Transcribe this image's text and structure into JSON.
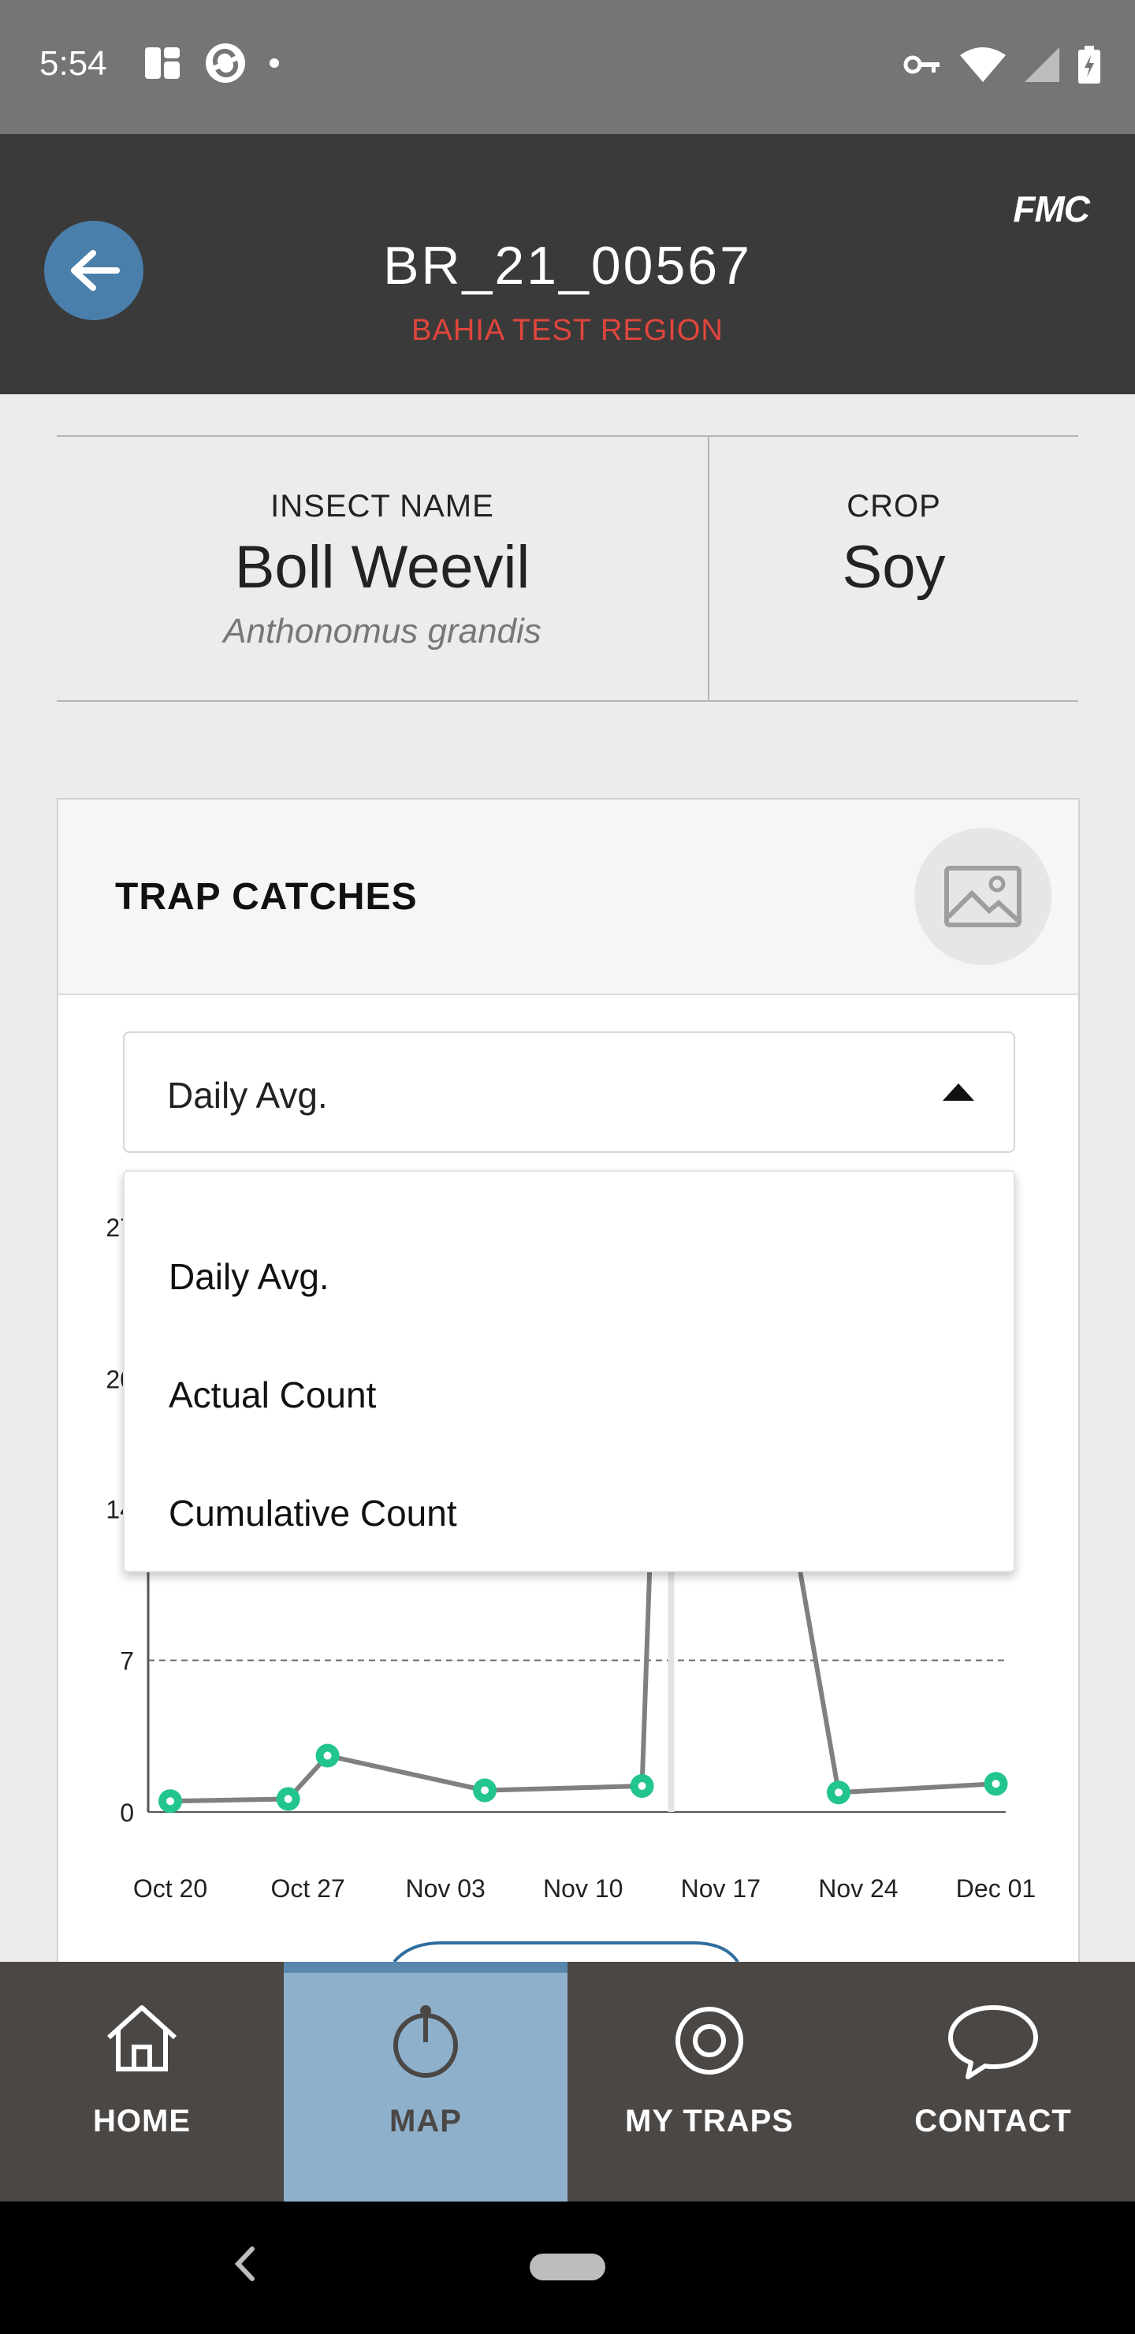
{
  "status_bar": {
    "time": "5:54",
    "icons": [
      "notification-icon",
      "sync-icon",
      "dot-icon",
      "key-icon",
      "wifi-icon",
      "signal-icon",
      "battery-icon"
    ]
  },
  "header": {
    "trap_id": "BR_21_00567",
    "region": "BAHIA TEST REGION",
    "brand": "FMC"
  },
  "info": {
    "insect_label": "INSECT NAME",
    "insect_name": "Boll Weevil",
    "insect_scientific": "Anthonomus grandis",
    "crop_label": "CROP",
    "crop_value": "Soy"
  },
  "trap_catches": {
    "title": "TRAP CATCHES",
    "selected_option": "Daily Avg.",
    "options": [
      "Daily Avg.",
      "Actual Count",
      "Cumulative Count"
    ]
  },
  "chart_data": {
    "type": "line",
    "x": [
      "Oct 20",
      "Oct 27",
      "Nov 03",
      "Nov 10",
      "Nov 17",
      "Nov 24",
      "Dec 01"
    ],
    "yticks": [
      0,
      7,
      14,
      20,
      27
    ],
    "ytick_labels": [
      "0",
      "7",
      "14",
      "20",
      "27"
    ],
    "threshold": 7,
    "points": [
      {
        "x": "Oct 20",
        "y": 0.5
      },
      {
        "x": "Oct 26",
        "y": 0.6
      },
      {
        "x": "Oct 28",
        "y": 2.6
      },
      {
        "x": "Nov 05",
        "y": 1.0
      },
      {
        "x": "Nov 13",
        "y": 1.2
      },
      {
        "x": "Nov 14",
        "y": 27
      },
      {
        "x": "Nov 18",
        "y": 27
      },
      {
        "x": "Nov 23",
        "y": 0.9
      },
      {
        "x": "Dec 01",
        "y": 1.3
      }
    ],
    "series_color": "#808080",
    "marker_color": "#22c58b"
  },
  "bottom_nav": {
    "items": [
      {
        "label": "HOME",
        "icon": "home-icon"
      },
      {
        "label": "MAP",
        "icon": "pin-icon"
      },
      {
        "label": "MY TRAPS",
        "icon": "target-icon"
      },
      {
        "label": "CONTACT",
        "icon": "chat-icon"
      }
    ],
    "active": "MAP"
  }
}
